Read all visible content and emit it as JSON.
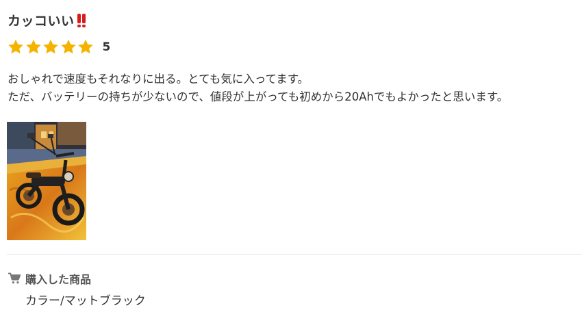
{
  "review": {
    "title": "カッコいい",
    "title_emoji": "‼",
    "rating": "5",
    "stars_filled": 5,
    "stars_total": 5,
    "star_color": "#f5b301",
    "body_lines": [
      "おしゃれで速度もそれなりに出る。とても気に入ってます。",
      "ただ、バッテリーの持ちが少ないので、値段が上がっても初めから20Ahでもよかったと思います。"
    ],
    "photo_subject": "e-bike photo (painterly style)",
    "purchase_label": "購入した商品",
    "purchase_variant": "カラー/マットブラック"
  }
}
